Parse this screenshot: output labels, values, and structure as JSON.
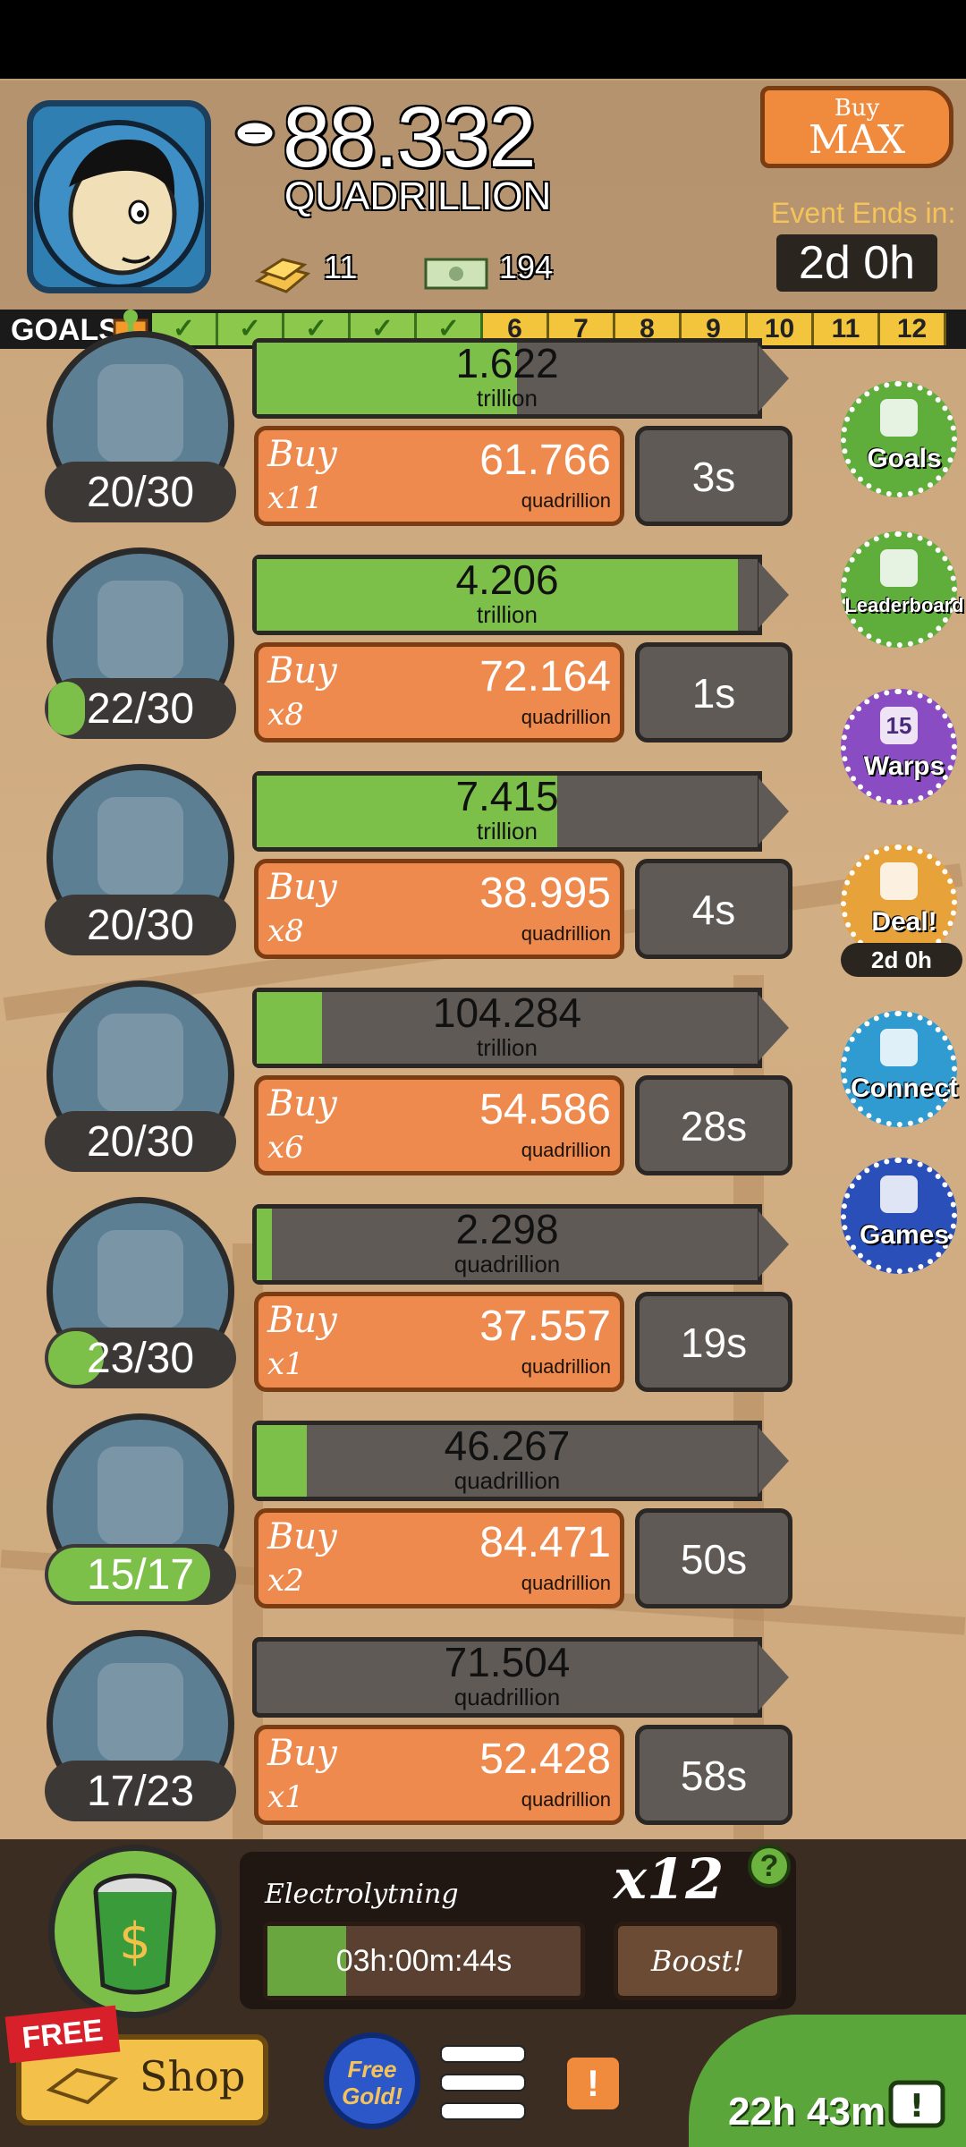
{
  "header": {
    "money_value": "88.332",
    "money_unit": "QUADRILLION",
    "gold_count": "11",
    "bills_count": "194",
    "buy_max_top": "Buy",
    "buy_max_bottom": "MAX",
    "event_label": "Event Ends in:",
    "event_time": "2d 0h"
  },
  "goals": {
    "label": "GOALS",
    "completed": 5,
    "numbers": [
      "6",
      "7",
      "8",
      "9",
      "10",
      "11",
      "12"
    ]
  },
  "rows": [
    {
      "icon": "backpack-icon",
      "count": "20/30",
      "level": 0.0,
      "prog_value": "1.622",
      "prog_unit": "trillion",
      "prog_fill": 0.52,
      "buy": "Buy",
      "mult": "x11",
      "price": "61.766",
      "price_unit": "quadrillion",
      "timer": "3s"
    },
    {
      "icon": "flaming-table-icon",
      "count": "22/30",
      "level": 0.2,
      "prog_value": "4.206",
      "prog_unit": "trillion",
      "prog_fill": 0.96,
      "buy": "Buy",
      "mult": "x8",
      "price": "72.164",
      "price_unit": "quadrillion",
      "timer": "1s"
    },
    {
      "icon": "soda-can-icon",
      "count": "20/30",
      "level": 0.0,
      "prog_value": "7.415",
      "prog_unit": "trillion",
      "prog_fill": 0.6,
      "buy": "Buy",
      "mult": "x8",
      "price": "38.995",
      "price_unit": "quadrillion",
      "timer": "4s"
    },
    {
      "icon": "glove-icon",
      "count": "20/30",
      "level": 0.0,
      "prog_value": "104.284",
      "prog_unit": "trillion",
      "prog_fill": 0.13,
      "buy": "Buy",
      "mult": "x6",
      "price": "54.586",
      "price_unit": "quadrillion",
      "timer": "28s"
    },
    {
      "icon": "frozen-chair-icon",
      "count": "23/30",
      "level": 0.3,
      "prog_value": "2.298",
      "prog_unit": "quadrillion",
      "prog_fill": 0.03,
      "buy": "Buy",
      "mult": "x1",
      "price": "37.557",
      "price_unit": "quadrillion",
      "timer": "19s"
    },
    {
      "icon": "3d-glasses-man-icon",
      "count": "15/17",
      "level": 0.88,
      "prog_value": "46.267",
      "prog_unit": "quadrillion",
      "prog_fill": 0.1,
      "buy": "Buy",
      "mult": "x2",
      "price": "84.471",
      "price_unit": "quadrillion",
      "timer": "50s"
    },
    {
      "icon": "jersey-icon",
      "count": "17/23",
      "level": 0.0,
      "prog_value": "71.504",
      "prog_unit": "quadrillion",
      "prog_fill": 0.0,
      "buy": "Buy",
      "mult": "x1",
      "price": "52.428",
      "price_unit": "quadrillion",
      "timer": "58s"
    }
  ],
  "side_buttons": [
    {
      "name": "goals",
      "label": "Goals",
      "color": "#5fae3c"
    },
    {
      "name": "leaderboard",
      "label": "Leaderboard",
      "color": "#5fae3c"
    },
    {
      "name": "warps",
      "label": "Warps",
      "badge": "15",
      "color": "#8a4cc2"
    },
    {
      "name": "deal",
      "label": "Deal!",
      "sub": "2d 0h",
      "color": "#e7a23a"
    },
    {
      "name": "connect",
      "label": "Connect",
      "color": "#2f9bd0"
    },
    {
      "name": "games",
      "label": "Games",
      "color": "#2a4fb8"
    }
  ],
  "boost": {
    "event_name": "Electrolytning",
    "multiplier": "x12",
    "help": "?",
    "timer": "03h:00m:44s",
    "timer_fill": 0.2,
    "button": "Boost!"
  },
  "nav": {
    "free": "FREE",
    "shop": "Shop",
    "free_gold": "Free Gold!",
    "alert": "!",
    "tv_time": "22h 43m"
  }
}
